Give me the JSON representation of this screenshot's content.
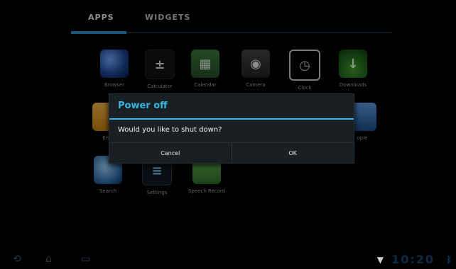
{
  "tabs": [
    {
      "label": "APPS"
    },
    {
      "label": "WIDGETS"
    }
  ],
  "apps": [
    {
      "label": "Browser",
      "icon": "browser-icon"
    },
    {
      "label": "Calculator",
      "icon": "calculator-icon"
    },
    {
      "label": "Calendar",
      "icon": "calendar-icon"
    },
    {
      "label": "Camera",
      "icon": "camera-icon"
    },
    {
      "label": "Clock",
      "icon": "clock-icon"
    },
    {
      "label": "Downloads",
      "icon": "downloads-icon"
    },
    {
      "label": "Em",
      "icon": "email-icon"
    },
    {
      "label": "ople",
      "icon": "people-icon"
    },
    {
      "label": "Search",
      "icon": "search-icon"
    },
    {
      "label": "Settings",
      "icon": "settings-icon"
    },
    {
      "label": "Speech Record",
      "icon": "speech-record-icon"
    }
  ],
  "dialog": {
    "title": "Power off",
    "message": "Would you like to shut down?",
    "cancel_label": "Cancel",
    "ok_label": "OK"
  },
  "status": {
    "time": "10:20"
  },
  "colors": {
    "accent": "#33b5e5",
    "tab_active": "#2b8fd0",
    "background": "#000000"
  }
}
